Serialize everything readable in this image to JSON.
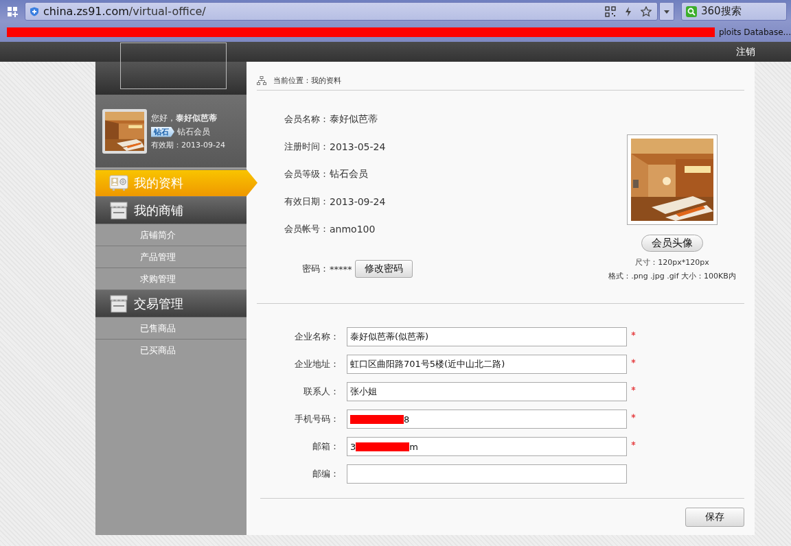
{
  "browser": {
    "url_host": "china.zs91.com",
    "url_path": "/virtual-office/",
    "search_text": "360搜索",
    "bookmarks": [
      {
        "kind": "redaction"
      },
      {
        "kind": "text",
        "text": "ploits Database..."
      }
    ]
  },
  "header": {
    "logout": "注销"
  },
  "profile": {
    "greeting": "您好，**泰好似芭蒂**",
    "badge": "钻石",
    "level": "钻石会员",
    "expiry": "有效期：2013-09-24"
  },
  "menu": [
    {
      "label": "我的资料",
      "kind": "card",
      "selected": true
    },
    {
      "label": "我的商铺",
      "kind": "shop",
      "selected": false,
      "children": [
        {
          "label": "店铺简介",
          "selected": false
        },
        {
          "label": "产品管理",
          "selected": false
        },
        {
          "label": "求购管理",
          "selected": false
        }
      ]
    },
    {
      "label": "交易管理",
      "kind": "shop",
      "selected": false,
      "children": [
        {
          "label": "已售商品",
          "selected": false
        },
        {
          "label": "已买商品",
          "selected": false
        }
      ]
    }
  ],
  "breadcrumb": "当前位置：我的资料",
  "info": [
    {
      "label": "会员名称：",
      "value": "泰好似芭蒂"
    },
    {
      "label": "注册时间：",
      "value": "2013-05-24"
    },
    {
      "label": "会员等级：",
      "value": "钻石会员"
    },
    {
      "label": "有效日期：",
      "value": "2013-09-24"
    },
    {
      "label": "会员帐号：",
      "value": "anmo100"
    }
  ],
  "password": {
    "label": "密码：",
    "value": "*****",
    "button": "修改密码"
  },
  "avatar": {
    "button": "会员头像",
    "size_note": "尺寸：120px*120px",
    "format_note": "格式：.png .jpg .gif 大小：100KB内"
  },
  "form": [
    {
      "label": "企业名称：",
      "required": true,
      "parts": [
        {
          "kind": "text",
          "text": "泰好似芭蒂(似芭蒂)"
        }
      ]
    },
    {
      "label": "企业地址：",
      "required": true,
      "parts": [
        {
          "kind": "text",
          "text": "虹口区曲阳路701号5楼(近中山北二路)"
        }
      ]
    },
    {
      "label": "联系人：",
      "required": true,
      "parts": [
        {
          "kind": "text",
          "text": "张小姐"
        }
      ]
    },
    {
      "label": "手机号码：",
      "required": true,
      "parts": [
        {
          "kind": "redaction"
        },
        {
          "kind": "text",
          "text": "8"
        }
      ]
    },
    {
      "label": "邮箱：",
      "required": true,
      "parts": [
        {
          "kind": "text",
          "text": "3"
        },
        {
          "kind": "redaction"
        },
        {
          "kind": "text",
          "text": "m"
        }
      ]
    },
    {
      "label": "邮编：",
      "required": false
    }
  ],
  "save": "保存"
}
